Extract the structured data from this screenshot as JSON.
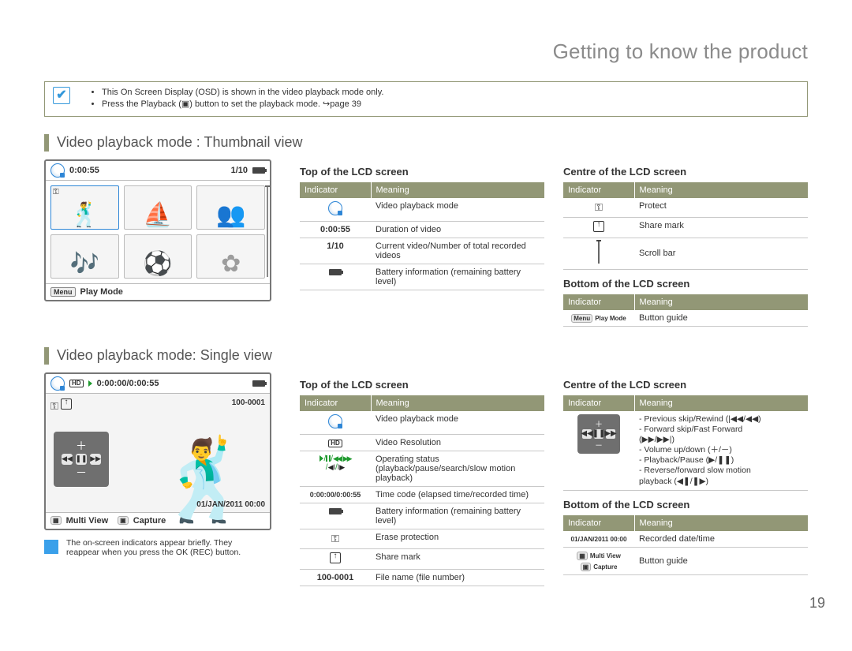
{
  "chapter_title": "Getting to know the product",
  "page_number": "19",
  "callout": {
    "items": [
      "This On Screen Display (OSD) is shown in the video playback mode only.",
      "Press the Playback (▣) button to set the playback mode. ↪page 39"
    ]
  },
  "section_1": {
    "heading": "Video playback mode : Thumbnail view",
    "screen": {
      "duration": "0:00:55",
      "counter": "1/10",
      "bottom_button": "Play Mode",
      "menu_label": "Menu"
    },
    "top": {
      "title": "Top of the LCD screen",
      "cols": {
        "indicator": "Indicator",
        "meaning": "Meaning"
      },
      "rows": [
        {
          "ind": "video-mode",
          "meaning": "Video playback mode"
        },
        {
          "ind_text": "0:00:55",
          "meaning": "Duration of video"
        },
        {
          "ind_text": "1/10",
          "meaning": "Current video/Number of total recorded videos"
        },
        {
          "ind": "battery",
          "meaning": "Battery information (remaining battery level)"
        }
      ]
    },
    "centre": {
      "title": "Centre of the LCD screen",
      "cols": {
        "indicator": "Indicator",
        "meaning": "Meaning"
      },
      "rows": [
        {
          "ind": "keylock",
          "meaning": "Protect"
        },
        {
          "ind": "share",
          "meaning": "Share mark"
        },
        {
          "ind": "scroll",
          "meaning": "Scroll bar"
        }
      ]
    },
    "bottom": {
      "title": "Bottom of the LCD screen",
      "cols": {
        "indicator": "Indicator",
        "meaning": "Meaning"
      },
      "rows": [
        {
          "ind_pill": "Menu",
          "ind_text": "Play Mode",
          "meaning": "Button guide"
        }
      ]
    }
  },
  "section_2": {
    "heading": "Video playback mode: Single view",
    "screen": {
      "hd": "HD",
      "timecode": "0:00:00/0:00:55",
      "file_no": "100-0001",
      "date": "01/JAN/2011 00:00",
      "multi_view_label": "Multi View",
      "capture_label": "Capture",
      "play_icon_label": "▶"
    },
    "top": {
      "title": "Top of the LCD screen",
      "cols": {
        "indicator": "Indicator",
        "meaning": "Meaning"
      },
      "rows": [
        {
          "ind": "video-mode",
          "meaning": "Video playback mode"
        },
        {
          "ind": "hd",
          "meaning": "Video Resolution"
        },
        {
          "ind": "play-combo",
          "meaning": "Operating status (playback/pause/search/slow motion playback)"
        },
        {
          "ind_text": "0:00:00/0:00:55",
          "meaning": "Time code (elapsed time/recorded time)"
        },
        {
          "ind": "battery",
          "meaning": "Battery information (remaining battery level)"
        },
        {
          "ind": "keylock",
          "meaning": "Erase protection"
        },
        {
          "ind": "share",
          "meaning": "Share mark"
        },
        {
          "ind_text": "100-0001",
          "meaning": "File name (file number)"
        }
      ]
    },
    "centre": {
      "title": "Centre of the LCD screen",
      "cols": {
        "indicator": "Indicator",
        "meaning": "Meaning"
      },
      "rows": [
        {
          "ind": "ctrl-mini",
          "meaning_lines": [
            "- Previous skip/Rewind (|◀◀/◀◀)",
            "- Forward skip/Fast Forward",
            "   (▶▶/▶▶|)",
            "- Volume up/down (＋/－)",
            "- Playback/Pause (▶/❚❚)",
            "- Reverse/forward slow motion",
            "   playback (◀❚/❚▶)"
          ]
        }
      ]
    },
    "bottom": {
      "title": "Bottom of the LCD screen",
      "cols": {
        "indicator": "Indicator",
        "meaning": "Meaning"
      },
      "rows": [
        {
          "ind_text": "01/JAN/2011 00:00",
          "meaning": "Recorded date/time"
        },
        {
          "ind_pill_multi": [
            "Multi View",
            "Capture"
          ],
          "meaning": "Button guide"
        }
      ]
    },
    "note": {
      "lines": [
        "The on-screen indicators appear briefly. They",
        "reappear when you press the OK (REC) button."
      ]
    }
  }
}
